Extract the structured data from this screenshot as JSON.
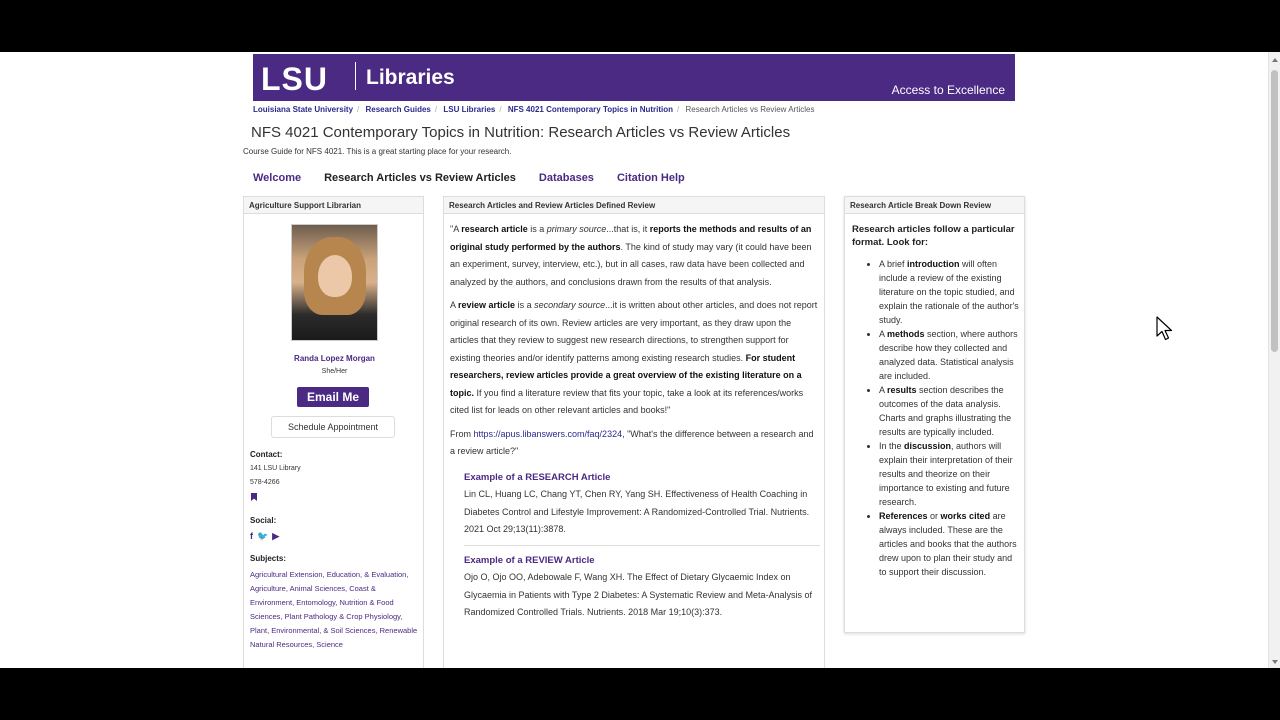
{
  "banner": {
    "logo_text": "LSU",
    "libraries": "Libraries",
    "tagline": "Access to Excellence"
  },
  "breadcrumbs": [
    "Louisiana State University",
    "Research Guides",
    "LSU Libraries",
    "NFS 4021 Contemporary Topics in Nutrition",
    "Research Articles vs Review Articles"
  ],
  "page": {
    "title": "NFS 4021 Contemporary Topics in Nutrition: Research Articles vs Review Articles",
    "description": "Course Guide for NFS 4021. This is a great starting place for your research."
  },
  "tabs": [
    {
      "label": "Welcome"
    },
    {
      "label": "Research Articles vs Review Articles"
    },
    {
      "label": "Databases"
    },
    {
      "label": "Citation Help"
    }
  ],
  "librarian": {
    "header": "Agriculture Support Librarian",
    "name": "Randa Lopez Morgan",
    "pronouns": "She/Her",
    "email_label": "Email Me",
    "schedule_label": "Schedule Appointment",
    "contact_label": "Contact:",
    "contact_line1": "141 LSU Library",
    "contact_line2": "578-4266",
    "social_label": "Social:",
    "subjects_label": "Subjects:",
    "subjects": "Agricultural Extension, Education, & Evaluation, Agriculture, Animal Sciences, Coast & Environment, Entomology, Nutrition & Food Sciences, Plant Pathology & Crop Physiology, Plant, Environmental, & Soil Sciences, Renewable Natural Resources, Science"
  },
  "middle": {
    "header": "Research Articles and Review Articles Defined Review",
    "p1_a": "\"A ",
    "p1_b": "research article",
    "p1_c": " is a ",
    "p1_d": "primary source",
    "p1_e": "...that is, it ",
    "p1_f": "reports the methods and results of an original study performed by the authors",
    "p1_g": ". The kind of study may vary (it could have been an experiment, survey, interview, etc.), but in all cases, raw data have been collected and analyzed by the authors, and conclusions drawn from the results of that analysis.",
    "p2_a": "A ",
    "p2_b": "review article",
    "p2_c": " is a ",
    "p2_d": "secondary source",
    "p2_e": "...it is written about other articles, and does not report original research of its own.  Review articles are very important, as they draw upon the articles that they review to suggest new research directions, to strengthen support for existing theories and/or identify patterns among existing research studies.  ",
    "p2_f": "For student researchers, review articles provide a great overview of the existing literature on a topic.",
    "p2_g": "   If you find a literature review that fits your topic, take a look at its references/works cited list for leads on other relevant articles and books!\"",
    "from_a": "From ",
    "from_link": "https://apus.libanswers.com/faq/2324",
    "from_b": ", \"What's the difference between a research and a review article?\"",
    "ex1_title": "Example of a RESEARCH Article",
    "ex1_text": "Lin CL, Huang LC, Chang YT, Chen RY, Yang SH. Effectiveness of Health Coaching in Diabetes Control and Lifestyle Improvement: A Randomized-Controlled Trial. Nutrients. 2021 Oct 29;13(11):3878.",
    "ex2_title": "Example of a REVIEW Article",
    "ex2_text": "Ojo O, Ojo OO, Adebowale F, Wang XH. The Effect of Dietary Glycaemic Index on Glycaemia in Patients with Type 2 Diabetes: A Systematic Review and Meta-Analysis of Randomized Controlled Trials. Nutrients. 2018 Mar 19;10(3):373."
  },
  "right": {
    "header": "Research Article Break Down Review",
    "intro": "Research articles follow a particular format.  Look for:",
    "items": [
      {
        "pre": "A brief ",
        "bold": "introduction",
        "post": " will often include a review of the existing literature on the topic studied, and explain the rationale of the author's study."
      },
      {
        "pre": "A ",
        "bold": "methods",
        "post": " section, where authors describe how they collected and analyzed data. Statistical analysis are included."
      },
      {
        "pre": "A ",
        "bold": "results",
        "post": " section describes the outcomes of the data analysis. Charts and graphs illustrating the results are typically included."
      },
      {
        "pre": "In the ",
        "bold": "discussion",
        "post": ", authors will explain their interpretation of their results and theorize on their importance to existing and future research."
      },
      {
        "pre": "",
        "bold": "References",
        "mid": " or ",
        "bold2": "works cited",
        "post": " are always included. These are the articles and books that the authors drew upon to plan their study and to support their discussion."
      }
    ]
  }
}
